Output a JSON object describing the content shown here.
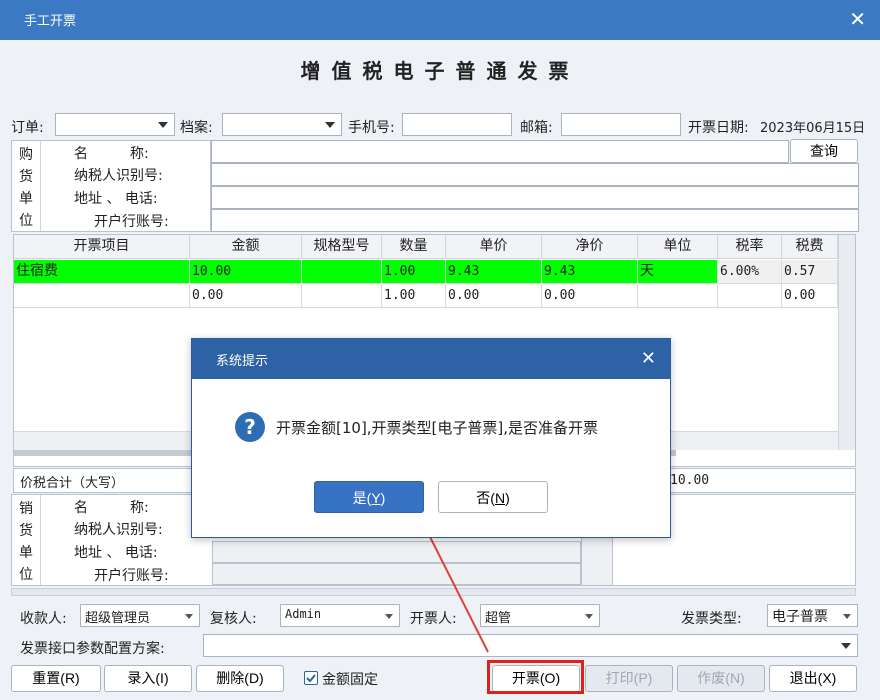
{
  "window": {
    "title": "手工开票"
  },
  "invoice_title": "增值税电子普通发票",
  "top_fields": {
    "order_label": "订单:",
    "archive_label": "档案:",
    "phone_label": "手机号:",
    "email_label": "邮箱:",
    "date_label": "开票日期:",
    "date_value": "2023年06月15日"
  },
  "buyer": {
    "side_chars": [
      "购",
      "货",
      "单",
      "位"
    ],
    "name_label": "名　　　称:",
    "tax_id_label": "纳税人识别号:",
    "address_label": "地址 、 电话:",
    "bank_label": "开户行账号:",
    "query_button": "查询"
  },
  "grid": {
    "headers": [
      "开票项目",
      "金额",
      "规格型号",
      "数量",
      "单价",
      "净价",
      "单位",
      "税率",
      "税费"
    ],
    "rows": [
      [
        "住宿费",
        "10.00",
        "",
        "1.00",
        "9.43",
        "9.43",
        "天",
        "6.00%",
        "0.57"
      ],
      [
        "",
        "0.00",
        "",
        "1.00",
        "0.00",
        "0.00",
        "",
        "",
        "0.00"
      ]
    ],
    "highlight_color": "#00ff00"
  },
  "total": {
    "label": "价税合计（大写）",
    "value": "10.00"
  },
  "seller": {
    "side_chars": [
      "销",
      "货",
      "单",
      "位"
    ],
    "name_label": "名　　　称:",
    "tax_id_label": "纳税人识别号:",
    "address_label": "地址 、 电话:",
    "bank_label": "开户行账号:"
  },
  "people": {
    "payee_label": "收款人:",
    "payee_value": "超级管理员",
    "reviewer_label": "复核人:",
    "reviewer_value": "Admin",
    "drawer_label": "开票人:",
    "drawer_value": "超管",
    "invoice_type_label": "发票类型:",
    "invoice_type_value": "电子普票"
  },
  "config": {
    "label": "发票接口参数配置方案:",
    "value": ""
  },
  "buttons": {
    "reset": "重置(R)",
    "entry": "录入(I)",
    "delete": "删除(D)",
    "fixed_amount": "金额固定",
    "issue": "开票(O)",
    "print": "打印(P)",
    "void": "作废(N)",
    "exit": "退出(X)"
  },
  "dialog": {
    "title": "系统提示",
    "message": "开票金额[10],开票类型[电子普票],是否准备开票",
    "yes_text": "是(",
    "yes_key": "Y",
    "no_text": "否(",
    "no_key": "N"
  },
  "colors": {
    "accent": "#3b79c2",
    "highlight_border": "#e0201b",
    "annotation_arrow": "#e0423a"
  }
}
